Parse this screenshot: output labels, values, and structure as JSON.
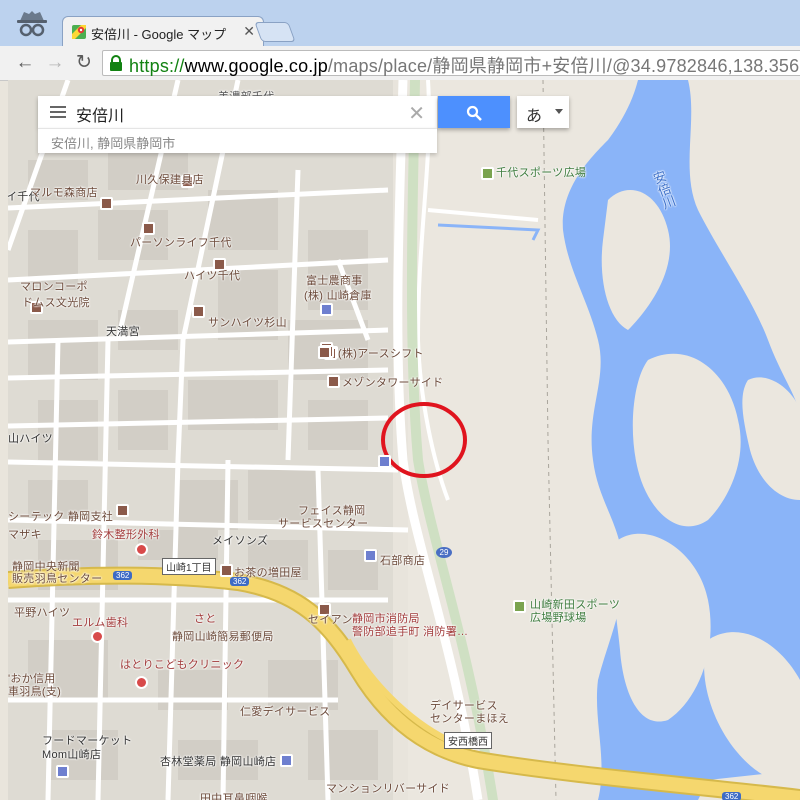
{
  "browser": {
    "tab_title": "安倍川 - Google マップ",
    "url_scheme": "https://",
    "url_host": "www.google.co.jp",
    "url_path": "/maps/place/静岡県静岡市+安倍川/@34.9782846,138.35667"
  },
  "search": {
    "query": "安倍川",
    "suggestion": "安倍川, 静岡県静岡市",
    "ime_label": "あ"
  },
  "map": {
    "labels": {
      "l_minamiyoshida": "美濃部千代",
      "l_chiyo": "イ千代",
      "l_kawakubo": "川久保建具店",
      "l_marumori": "マルモ森商店",
      "l_personal": "パーソンライフ千代",
      "l_heights": "ハイツ千代",
      "l_maron": "マロンコーポ",
      "l_domusu": "ドムス文光院",
      "l_fujino": "富士農商事",
      "l_yamazaki": "(株) 山崎倉庫",
      "l_sunheights": "サンハイツ杉山",
      "l_tenman": "天満宮",
      "l_arsshift": "(株)アースシフト",
      "l_maison": "メゾンタワーサイド",
      "l_heights2": "山ハイツ",
      "l_cetec": "シーテック 静岡支社",
      "l_suzuki": "鈴木整形外科",
      "l_zagi": "マザキ",
      "l_feith": "フェイス静岡",
      "l_feith2": "サービスセンター",
      "l_maisons": "メイソンズ",
      "l_shizuokashinbun": "静岡中央新聞",
      "l_hanbai": "販売羽鳥センター",
      "l_yamazaki1": "山崎1丁目",
      "l_ochamasuda": "お茶の増田屋",
      "l_ishibe": "石部商店",
      "l_hirano": "平野ハイツ",
      "l_ermin": "エルム歯科",
      "l_satoh": "さと",
      "l_seian": "セイアン",
      "l_fire1": "静岡市消防局",
      "l_fire2": "警防部追手町 消防署…",
      "l_post": "静岡山崎簡易郵便局",
      "l_hatori": "はとりこどもクリニック",
      "l_okashin": "'おか信用",
      "l_okashin2": "車羽鳥(支)",
      "l_dayservice": "デイサービス",
      "l_dayservice2": "センターまほえ",
      "l_jinsei": "仁愛デイサービス",
      "l_food": "フードマーケット",
      "l_food2": "Mom山崎店",
      "l_kyorin": "杏林堂薬局 静岡山崎店",
      "l_mansion": "マンションリバーサイド",
      "l_tanaka": "田中耳鼻咽喉",
      "l_chiyosports": "千代スポーツ広場",
      "l_yamazakishinden": "山崎新田スポーツ",
      "l_yamazakishinden2": "広場野球場",
      "l_abekawa": "安倍川",
      "l_anzaibashi": "安西橋西",
      "shield_362a": "362",
      "shield_362b": "362",
      "shield_29": "29",
      "shield_362c": "362"
    }
  },
  "colors": {
    "water": "#8ab4f8",
    "highway": "#f5d76e",
    "annotation": "#e0141e",
    "search_button": "#4d90fe"
  }
}
